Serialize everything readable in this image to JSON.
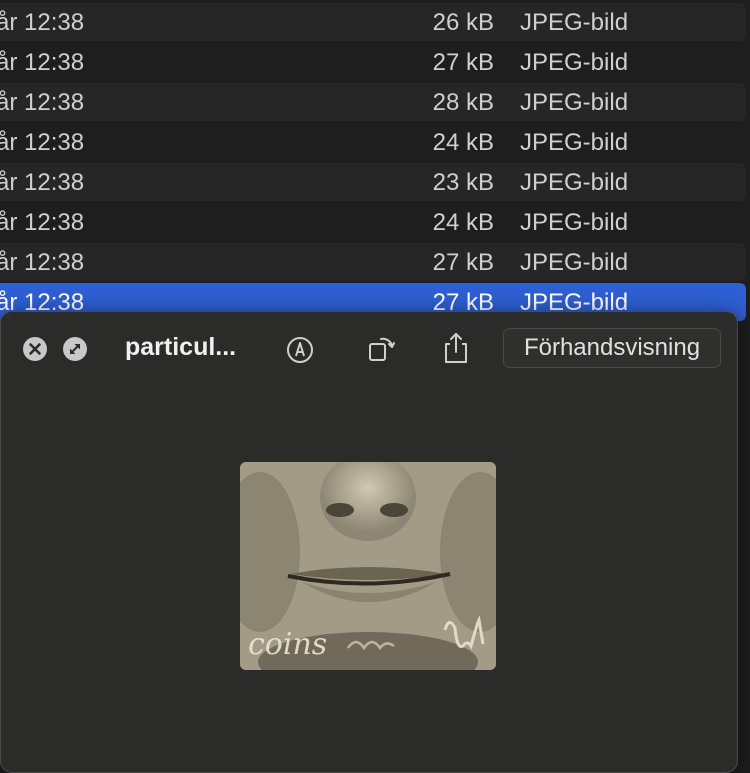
{
  "file_rows": [
    {
      "date": "år 12:38",
      "size": "26 kB",
      "kind": "JPEG-bild"
    },
    {
      "date": "år 12:38",
      "size": "27 kB",
      "kind": "JPEG-bild"
    },
    {
      "date": "år 12:38",
      "size": "28 kB",
      "kind": "JPEG-bild"
    },
    {
      "date": "år 12:38",
      "size": "24 kB",
      "kind": "JPEG-bild"
    },
    {
      "date": "år 12:38",
      "size": "23 kB",
      "kind": "JPEG-bild"
    },
    {
      "date": "år 12:38",
      "size": "24 kB",
      "kind": "JPEG-bild"
    },
    {
      "date": "år 12:38",
      "size": "27 kB",
      "kind": "JPEG-bild"
    },
    {
      "date": "år 12:38",
      "size": "27 kB",
      "kind": "JPEG-bild"
    }
  ],
  "selected_row_index": 7,
  "quicklook": {
    "title": "particul...",
    "open_with_label": "Förhandsvisning",
    "image_caption": "coins",
    "icons": {
      "close": "close-icon",
      "fullscreen": "fullscreen-icon",
      "markup": "markup-pen-icon",
      "rotate": "rotate-icon",
      "share": "share-icon"
    }
  },
  "colors": {
    "selection": "#2f5fd4",
    "row_stripe": "#262626",
    "background": "#1e1e1e",
    "panel": "#2b2b2a"
  }
}
